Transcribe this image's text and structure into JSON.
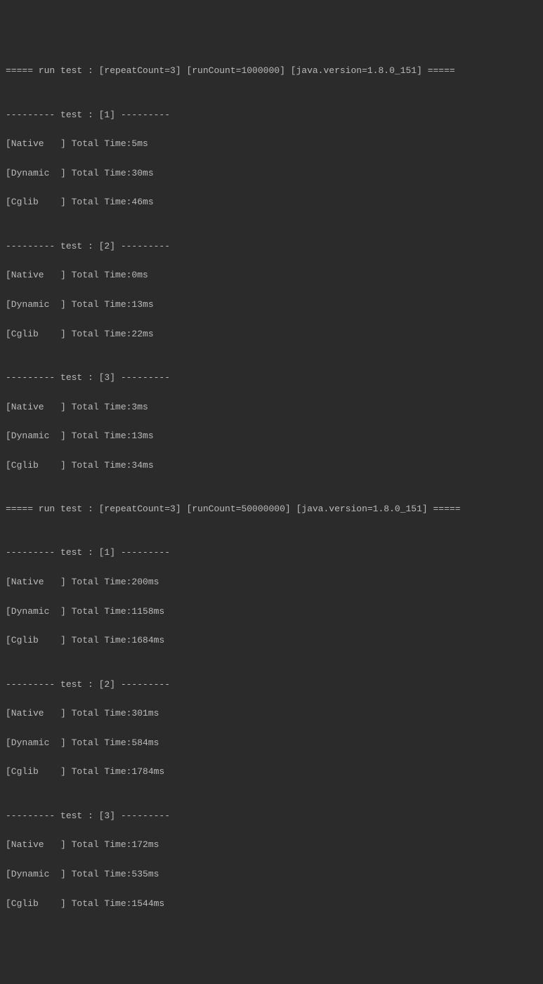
{
  "runs": [
    {
      "header": "===== run test : [repeatCount=3] [runCount=1000000] [java.version=1.8.0_151] =====",
      "tests": [
        {
          "header": "--------- test : [1] ---------",
          "results": [
            "[Native   ] Total Time:5ms",
            "[Dynamic  ] Total Time:30ms",
            "[Cglib    ] Total Time:46ms"
          ]
        },
        {
          "header": "--------- test : [2] ---------",
          "results": [
            "[Native   ] Total Time:0ms",
            "[Dynamic  ] Total Time:13ms",
            "[Cglib    ] Total Time:22ms"
          ]
        },
        {
          "header": "--------- test : [3] ---------",
          "results": [
            "[Native   ] Total Time:3ms",
            "[Dynamic  ] Total Time:13ms",
            "[Cglib    ] Total Time:34ms"
          ]
        }
      ]
    },
    {
      "header": "===== run test : [repeatCount=3] [runCount=50000000] [java.version=1.8.0_151] =====",
      "tests": [
        {
          "header": "--------- test : [1] ---------",
          "results": [
            "[Native   ] Total Time:200ms",
            "[Dynamic  ] Total Time:1158ms",
            "[Cglib    ] Total Time:1684ms"
          ]
        },
        {
          "header": "--------- test : [2] ---------",
          "results": [
            "[Native   ] Total Time:301ms",
            "[Dynamic  ] Total Time:584ms",
            "[Cglib    ] Total Time:1784ms"
          ]
        },
        {
          "header": "--------- test : [3] ---------",
          "results": [
            "[Native   ] Total Time:172ms",
            "[Dynamic  ] Total Time:535ms",
            "[Cglib    ] Total Time:1544ms"
          ]
        }
      ]
    }
  ]
}
